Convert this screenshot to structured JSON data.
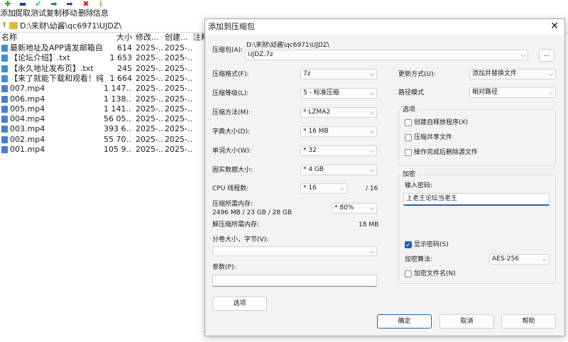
{
  "toolbar": {
    "items": [
      {
        "label": "添加",
        "icon": "plus-icon",
        "glyph": "✚",
        "color": "#2aa32a"
      },
      {
        "label": "提取",
        "icon": "minus-icon",
        "glyph": "▬",
        "color": "#1e3fa8"
      },
      {
        "label": "测试",
        "icon": "check-icon",
        "glyph": "✔",
        "color": "#2aa0c8"
      },
      {
        "label": "复制",
        "icon": "copy-arrow-icon",
        "glyph": "➡",
        "color": "#1f8a3a"
      },
      {
        "label": "移动",
        "icon": "move-arrow-icon",
        "glyph": "➡",
        "color": "#1e3fa8"
      },
      {
        "label": "删除",
        "icon": "delete-icon",
        "glyph": "✖",
        "color": "#d32020"
      },
      {
        "label": "信息",
        "icon": "info-icon",
        "glyph": "ℹ",
        "color": "#c8a020"
      }
    ]
  },
  "address": {
    "path": "D:\\来财\\幼酱\\qc6971\\UJDZ\\"
  },
  "file_list": {
    "headers": {
      "name": "名称",
      "size": "大小",
      "modified": "修改...",
      "created": "创建...",
      "comment": "注释"
    },
    "rows": [
      {
        "name": "最新地址及APP请发邮箱自动...",
        "size": "614",
        "modified": "2025-...",
        "created": "2025-...",
        "type": "txt"
      },
      {
        "name": "【论坛介绍】.txt",
        "size": "1 653",
        "modified": "2025-...",
        "created": "2025-...",
        "type": "txt"
      },
      {
        "name": "【永久地址发布页】.txt",
        "size": "245",
        "modified": "2025-...",
        "created": "2025-...",
        "type": "txt"
      },
      {
        "name": "【来了就能下载和观看！纯免...",
        "size": "1 664",
        "modified": "2025-...",
        "created": "2025-...",
        "type": "txt"
      },
      {
        "name": "007.mp4",
        "size": "1 147...",
        "modified": "2025-...",
        "created": "2025-...",
        "type": "mp4"
      },
      {
        "name": "006.mp4",
        "size": "1 138...",
        "modified": "2025-...",
        "created": "2025-...",
        "type": "mp4"
      },
      {
        "name": "005.mp4",
        "size": "1 141...",
        "modified": "2025-...",
        "created": "2025-...",
        "type": "mp4"
      },
      {
        "name": "004.mp4",
        "size": "56 05...",
        "modified": "2025-...",
        "created": "2025-...",
        "type": "mp4"
      },
      {
        "name": "003.mp4",
        "size": "393 6...",
        "modified": "2025-...",
        "created": "2025-...",
        "type": "mp4"
      },
      {
        "name": "002.mp4",
        "size": "55 70...",
        "modified": "2025-...",
        "created": "2025-...",
        "type": "mp4"
      },
      {
        "name": "001.mp4",
        "size": "105 9...",
        "modified": "2025-...",
        "created": "2025-...",
        "type": "mp4"
      }
    ]
  },
  "dialog": {
    "title": "添加到压缩包",
    "archive_label": "压缩包(A):",
    "archive_dir": "D:\\来财\\幼酱\\qc6971\\UJDZ\\",
    "archive_name": "UJDZ.7z",
    "browse_label": "...",
    "left": {
      "format_label": "压缩格式(F):",
      "format_value": "7z",
      "level_label": "压缩等级(L):",
      "level_value": "5 - 标准压缩",
      "method_label": "压缩方法(M):",
      "method_value": "*  LZMA2",
      "dict_label": "字典大小(D):",
      "dict_value": "*  16 MB",
      "word_label": "单词大小(W):",
      "word_value": "*  32",
      "solid_label": "固实数据大小:",
      "solid_value": "*  4 GB",
      "cpu_label": "CPU 线程数:",
      "cpu_value": "*  16",
      "cpu_max": "/ 16",
      "mem_comp_label": "压缩所需内存:",
      "mem_comp_value": "2496 MB / 23 GB / 28 GB",
      "mem_pct": "* 80%",
      "mem_decomp_label": "解压缩所需内存:",
      "mem_decomp_value": "18 MB",
      "split_label": "分卷大小，字节(V):",
      "split_value": "",
      "params_label": "参数(P):",
      "params_value": "",
      "options_button": "选项"
    },
    "right": {
      "update_label": "更新方式(U):",
      "update_value": "添加并替换文件",
      "path_label": "路径模式",
      "path_value": "相对路径",
      "options_group": "选项",
      "opt_sfx": "创建自释放程序(X)",
      "opt_sfx_checked": false,
      "opt_shared": "压缩共享文件",
      "opt_shared_checked": false,
      "opt_delete": "操作完成后删除源文件",
      "opt_delete_checked": false,
      "encrypt_group": "加密",
      "password_label": "输入密码:",
      "password_value": "上老王论坛当老王",
      "show_pw": "显示密码(S)",
      "show_pw_checked": true,
      "enc_method_label": "加密算法:",
      "enc_method_value": "AES-256",
      "enc_names": "加密文件名(N)",
      "enc_names_checked": false
    },
    "buttons": {
      "ok": "确定",
      "cancel": "取消",
      "help": "帮助"
    }
  }
}
